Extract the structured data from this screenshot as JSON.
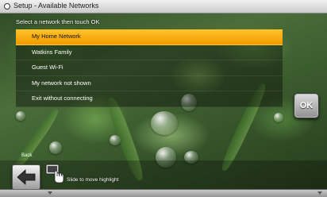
{
  "window": {
    "title": "Setup - Available Networks"
  },
  "instruction": "Select a network then touch OK",
  "networks": [
    {
      "label": "My Home Network",
      "selected": true
    },
    {
      "label": "Watkins Family",
      "selected": false
    },
    {
      "label": "Guest Wi-Fi",
      "selected": false
    },
    {
      "label": "My network not shown",
      "selected": false
    },
    {
      "label": "Exit without connecting",
      "selected": false
    }
  ],
  "buttons": {
    "ok": "OK",
    "back": "Back"
  },
  "slider": {
    "hint": "Slide to move highlight"
  },
  "icons": {
    "back": "left-arrow-icon",
    "slide": "touch-hand-icon",
    "title": "radio-dot-icon"
  },
  "colors": {
    "highlight": "#f7a800",
    "titlebar": "#dcdcdc"
  }
}
